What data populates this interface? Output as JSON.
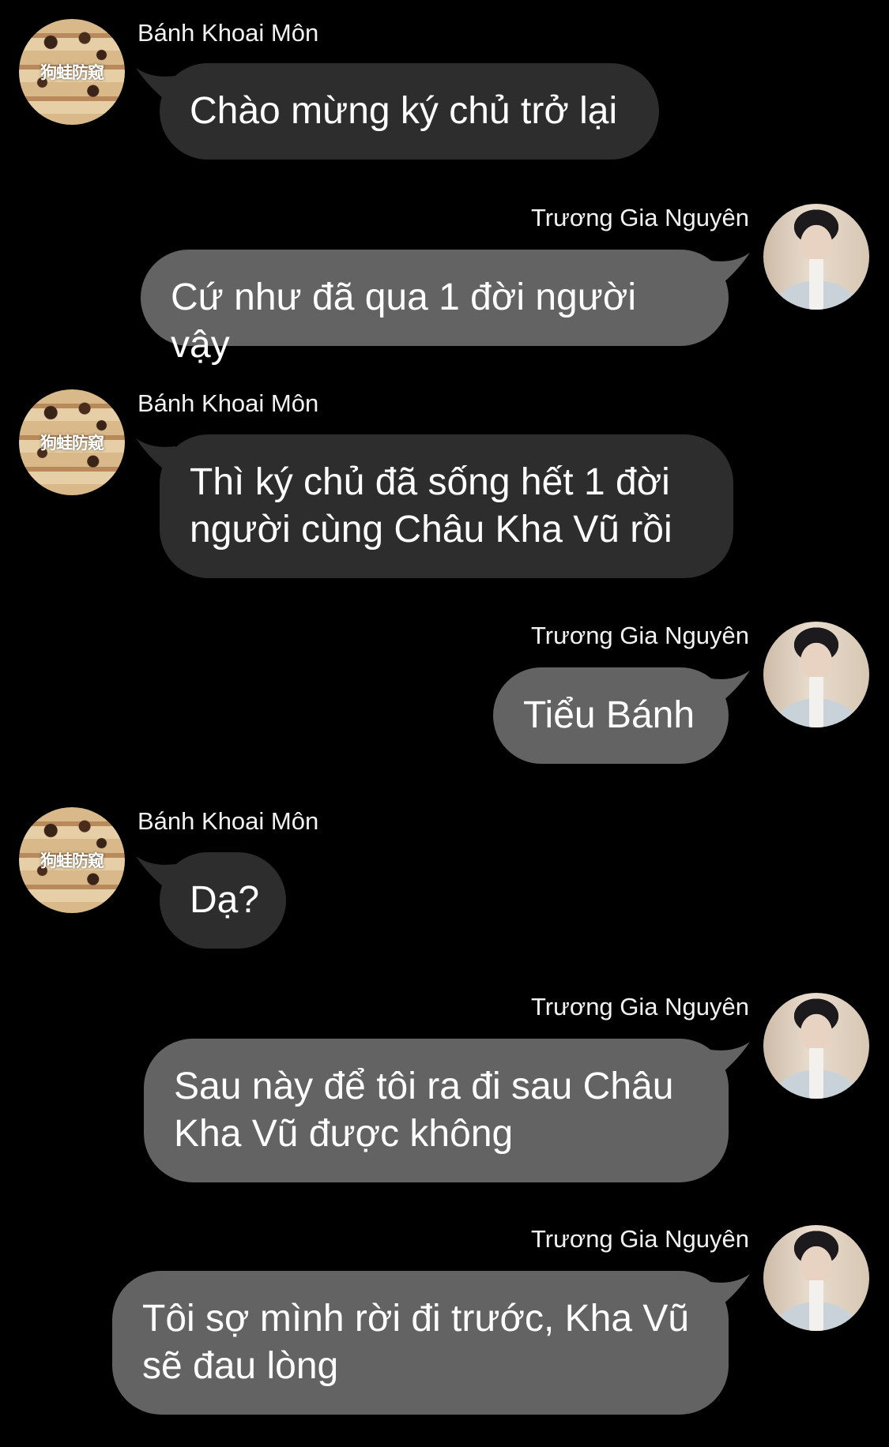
{
  "colors": {
    "background": "#000000",
    "incoming_bubble": "#2d2d2d",
    "outgoing_bubble": "#636363",
    "text": "#ffffff"
  },
  "avatars": {
    "banh_khoai_mon": {
      "icon": "cake-stack-avatar",
      "watermark": "狗蛙防窥"
    },
    "truong_gia_nguyen": {
      "icon": "person-portrait-avatar"
    }
  },
  "messages": [
    {
      "side": "left",
      "sender": "Bánh Khoai Môn",
      "text": "Chào mừng ký chủ trở lại"
    },
    {
      "side": "right",
      "sender": "Trương Gia Nguyên",
      "text": "Cứ như đã qua 1 đời người vậy"
    },
    {
      "side": "left",
      "sender": "Bánh Khoai Môn",
      "text": "Thì ký chủ đã sống hết 1  đời người cùng Châu Kha Vũ rồi"
    },
    {
      "side": "right",
      "sender": "Trương Gia Nguyên",
      "text": "Tiểu Bánh"
    },
    {
      "side": "left",
      "sender": "Bánh Khoai Môn",
      "text": "Dạ?"
    },
    {
      "side": "right",
      "sender": "Trương Gia Nguyên",
      "text": "Sau này để tôi ra đi sau Châu Kha Vũ được không"
    },
    {
      "side": "right",
      "sender": "Trương Gia Nguyên",
      "text": "Tôi sợ mình rời đi trước, Kha Vũ sẽ đau lòng"
    }
  ]
}
